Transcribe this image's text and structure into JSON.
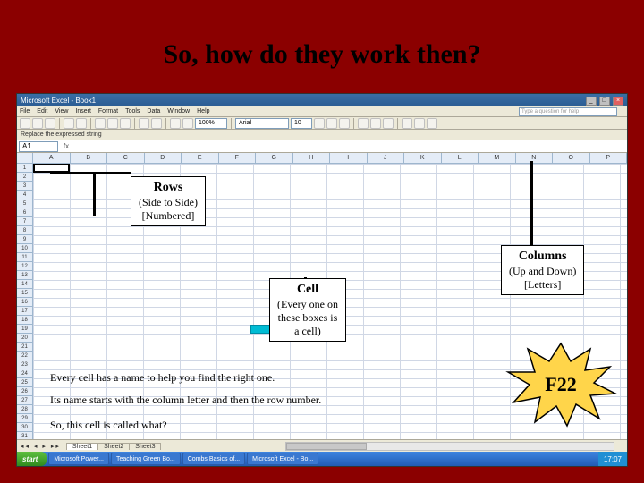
{
  "slide": {
    "title": "So, how do they work then?"
  },
  "excel": {
    "title": "Microsoft Excel - Book1",
    "menus": [
      "File",
      "Edit",
      "View",
      "Insert",
      "Format",
      "Tools",
      "Data",
      "Window",
      "Help"
    ],
    "askbox": "Type a question for help",
    "findbar_text": "Replace the expressed string",
    "font": "Arial",
    "fontsize": "10",
    "zoom": "100%",
    "namebox": "A1",
    "columns": [
      "A",
      "B",
      "C",
      "D",
      "E",
      "F",
      "G",
      "H",
      "I",
      "J",
      "K",
      "L",
      "M",
      "N",
      "O",
      "P"
    ],
    "row_count": 32,
    "sheets": [
      "Sheet1",
      "Sheet2",
      "Sheet3"
    ]
  },
  "callouts": {
    "rows": {
      "title": "Rows",
      "line1": "(Side to Side)",
      "line2": "[Numbered]"
    },
    "columns": {
      "title": "Columns",
      "line1": "(Up and Down)",
      "line2": "[Letters]"
    },
    "cell": {
      "title": "Cell",
      "line1": "(Every one on",
      "line2": "these boxes is",
      "line3": "a cell)"
    }
  },
  "notes": {
    "n1": "Every cell has a name to help you find the right one.",
    "n2": "Its name starts with the column letter and then the row number.",
    "n3": "So, this cell is called what?"
  },
  "answer": "F22",
  "taskbar": {
    "start": "start",
    "items": [
      "Microsoft Power...",
      "Teaching Green Bo...",
      "Combs Basics of...",
      "Microsoft Excel - Bo..."
    ],
    "clock": "17:07"
  }
}
